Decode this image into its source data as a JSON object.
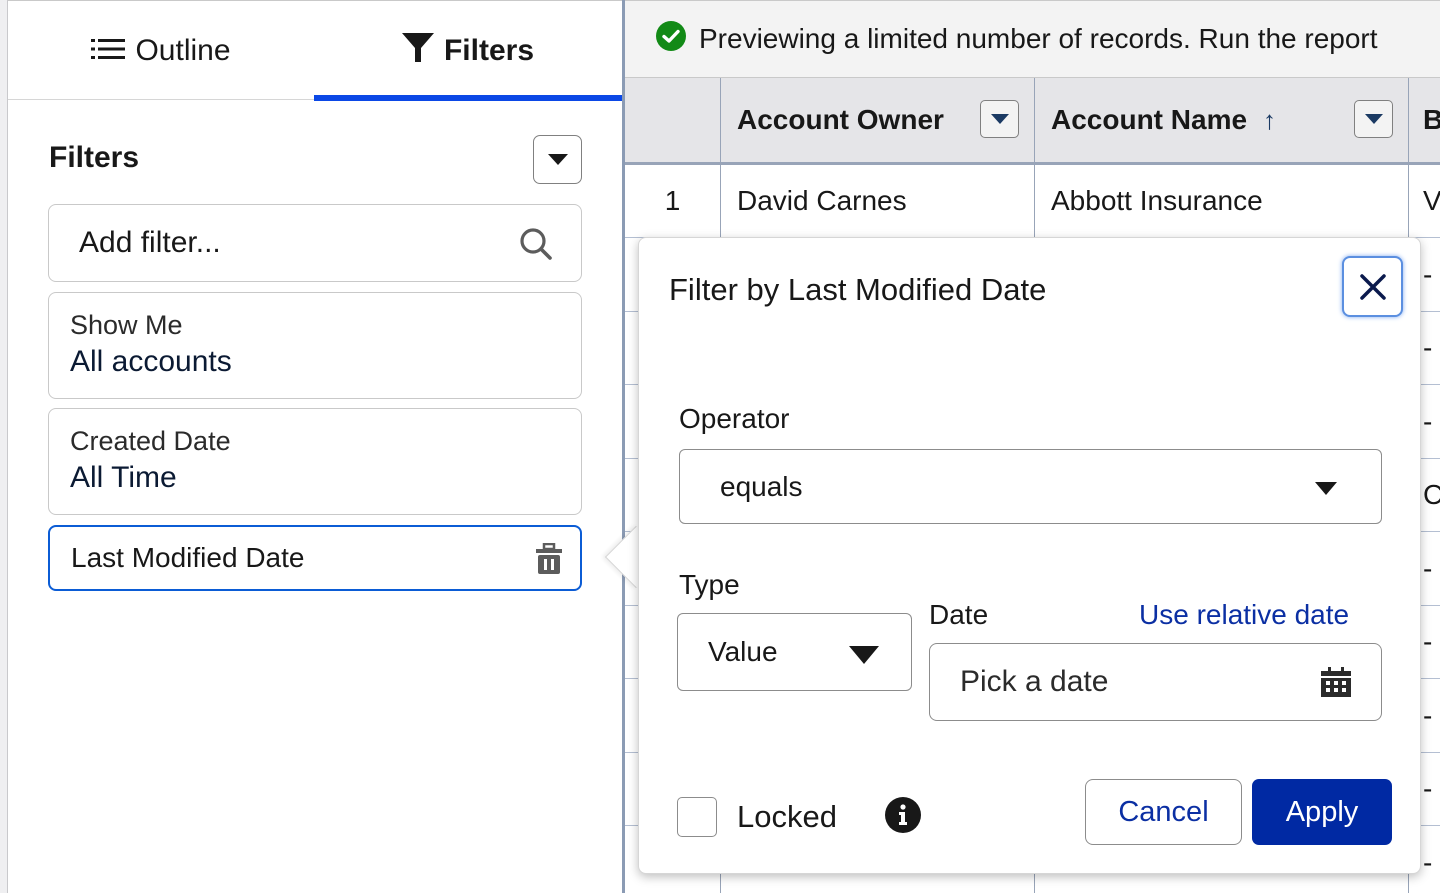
{
  "left_panel": {
    "tabs": [
      {
        "label": "Outline",
        "icon": "list-icon",
        "active": false
      },
      {
        "label": "Filters",
        "icon": "funnel-icon",
        "active": true
      }
    ],
    "filters_heading": "Filters",
    "add_filter_placeholder": "Add filter...",
    "filters": [
      {
        "label": "Show Me",
        "value": "All accounts"
      },
      {
        "label": "Created Date",
        "value": "All Time"
      },
      {
        "label": "Last Modified Date",
        "value": "",
        "selected": true
      }
    ]
  },
  "report": {
    "banner": "Previewing a limited number of records. Run the report",
    "columns": [
      {
        "label": "",
        "key": "row_num"
      },
      {
        "label": "Account Owner",
        "key": "owner"
      },
      {
        "label": "Account Name",
        "key": "name",
        "sort": "ascending"
      },
      {
        "label": "B",
        "key": "b"
      }
    ],
    "rows": [
      {
        "num": "1",
        "owner": "David Carnes",
        "name": "Abbott Insurance",
        "b": "V"
      },
      {
        "num": "",
        "owner": "",
        "name": "",
        "b": "-"
      },
      {
        "num": "",
        "owner": "",
        "name": "",
        "b": "-"
      },
      {
        "num": "",
        "owner": "",
        "name": "",
        "b": "-"
      },
      {
        "num": "",
        "owner": "",
        "name": "",
        "b": "C"
      },
      {
        "num": "",
        "owner": "",
        "name": "",
        "b": "-"
      },
      {
        "num": "",
        "owner": "",
        "name": "",
        "b": "-"
      },
      {
        "num": "",
        "owner": "",
        "name": "",
        "b": "-"
      },
      {
        "num": "",
        "owner": "",
        "name": "",
        "b": "-"
      },
      {
        "num": "",
        "owner": "",
        "name": "",
        "b": "-"
      }
    ]
  },
  "popover": {
    "title": "Filter by Last Modified Date",
    "operator_label": "Operator",
    "operator_value": "equals",
    "type_label": "Type",
    "type_value": "Value",
    "date_label": "Date",
    "relative_link": "Use relative date",
    "date_placeholder": "Pick a date",
    "locked_label": "Locked",
    "locked_checked": false,
    "cancel_label": "Cancel",
    "apply_label": "Apply"
  },
  "colors": {
    "accent_tab": "#0b48e6",
    "link": "#0b2fa3",
    "apply_bg": "#0029a3",
    "success": "#128a16",
    "annotation_arrow": "#c0232f"
  }
}
